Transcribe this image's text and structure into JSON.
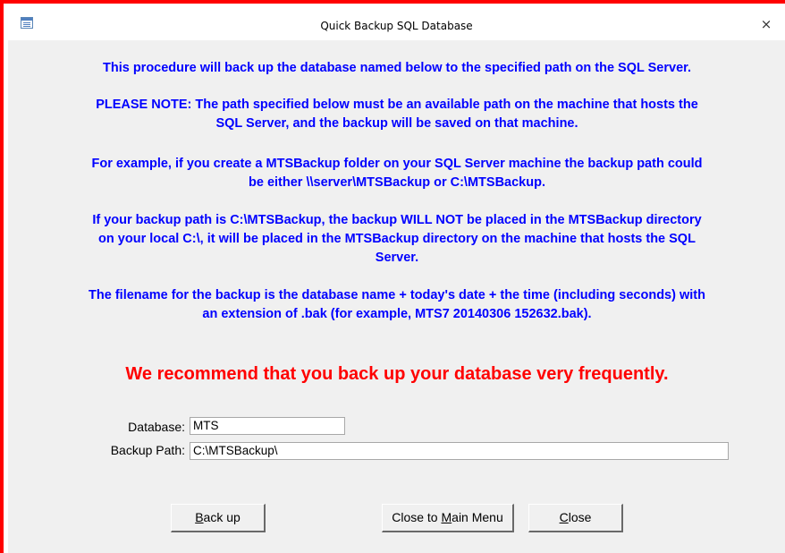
{
  "window": {
    "title": "Quick Backup SQL Database",
    "close_glyph": "×",
    "app_icon": "form-icon"
  },
  "info": {
    "para1": "This procedure will back up the database named below to the specified path on the SQL Server.",
    "para2_line1": "PLEASE NOTE:  The path specified below must be an available path on the machine that hosts the",
    "para2_line2": "SQL Server, and the backup will be saved on that machine.",
    "para3_line1": "For example, if you create a MTSBackup folder on your SQL Server machine the backup path could",
    "para3_line2": "be either \\\\server\\MTSBackup or C:\\MTSBackup.",
    "para4_line1": "If your backup path is C:\\MTSBackup, the backup WILL NOT be placed in the MTSBackup directory",
    "para4_line2": "on your local C:\\, it will be placed in the MTSBackup directory on the machine that hosts the SQL",
    "para4_line3": "Server.",
    "para5_line1": "The filename for the backup is the database name + today's date + the time (including seconds) with",
    "para5_line2": "an extension of .bak (for example, MTS7 20140306 152632.bak)."
  },
  "recommendation": "We recommend that you back up your database very frequently.",
  "form": {
    "database_label": "Database:",
    "database_value": "MTS",
    "backup_path_label": "Backup Path:",
    "backup_path_value": "C:\\MTSBackup\\"
  },
  "buttons": {
    "backup_mnemonic": "B",
    "backup_rest": "ack up",
    "close_main_prefix": "Close to ",
    "close_main_mnemonic": "M",
    "close_main_rest": "ain Menu",
    "close_mnemonic": "C",
    "close_rest": "lose"
  },
  "colors": {
    "info_text": "#0000ff",
    "recommend_text": "#ff0000",
    "frame_red": "#ff0000",
    "dialog_bg": "#f0f0f0"
  }
}
